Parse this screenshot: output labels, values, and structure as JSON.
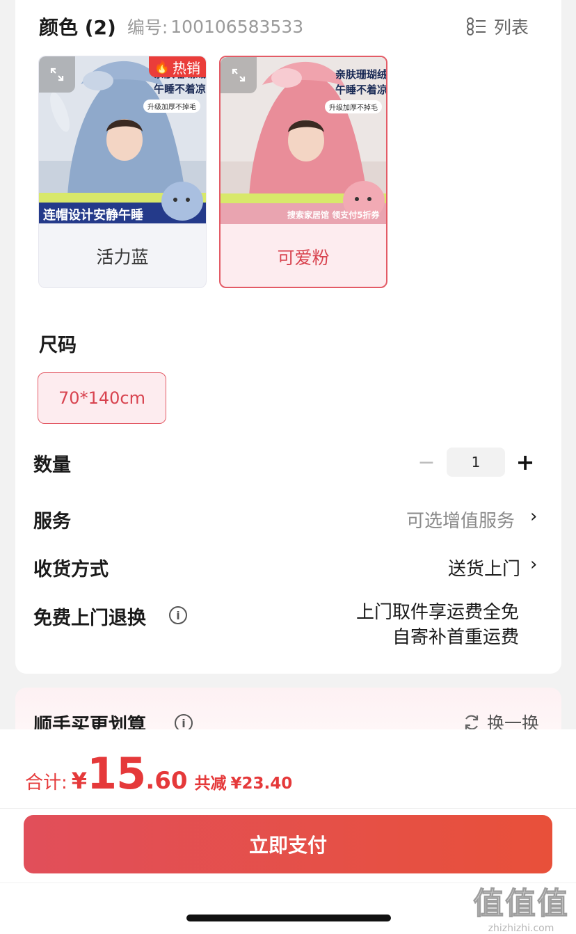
{
  "color_section": {
    "title": "颜色 (2)",
    "code_label": "编号:",
    "code": "100106583533",
    "list_toggle": "列表",
    "options": [
      {
        "label": "活力蓝",
        "badge": "热销",
        "selected": false,
        "overlay_top": "亲肤珊瑚绒",
        "overlay_mid": "午睡不着凉",
        "overlay_small": "升级加厚不掉毛",
        "overlay_banner": "连帽设计安静午睡"
      },
      {
        "label": "可爱粉",
        "selected": true,
        "overlay_top": "亲肤珊瑚绒",
        "overlay_mid": "午睡不着凉",
        "overlay_small": "升级加厚不掉毛",
        "overlay_banner": "搜索家居馆 领支付5折券"
      }
    ]
  },
  "size_section": {
    "title": "尺码",
    "options": [
      {
        "label": "70*140cm",
        "selected": true
      }
    ]
  },
  "quantity": {
    "label": "数量",
    "minus": "−",
    "value": "1",
    "plus": "+"
  },
  "service": {
    "label": "服务",
    "value": "可选增值服务",
    "chevron": "›"
  },
  "delivery": {
    "label": "收货方式",
    "value": "送货上门",
    "chevron": "›"
  },
  "free_return": {
    "label": "免费上门退换",
    "info": "i",
    "line1": "上门取件享运费全免",
    "line2": "自寄补首重运费"
  },
  "bundle": {
    "title": "顺手买更划算",
    "info": "i",
    "refresh": "换一换"
  },
  "checkout": {
    "total_label": "合计:",
    "currency": "¥",
    "price_int": "15",
    "price_dec": ".60",
    "saved_label": "共减",
    "saved": "¥23.40",
    "pay_button": "立即支付"
  },
  "watermark": {
    "logo": "值值值",
    "url": "zhizhizhi.com"
  },
  "colors": {
    "accent": "#e5393a",
    "selected_bg": "#fdecef",
    "selected_border": "#e35b66"
  }
}
